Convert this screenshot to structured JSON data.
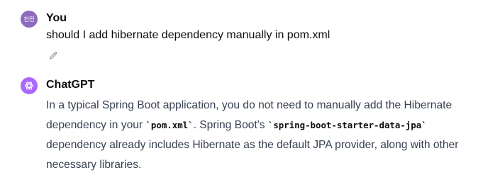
{
  "user_message": {
    "avatar_text": "찬민",
    "author": "You",
    "text": "should I add hibernate dependency manually in pom.xml",
    "edit_icon": "pencil-icon"
  },
  "assistant_message": {
    "avatar_icon": "openai-logo-icon",
    "author": "ChatGPT",
    "parts": {
      "p1": "In a typical Spring Boot application, you do not need to manually add the Hibernate dependency in your ",
      "code1": "`pom.xml`",
      "p2": ". Spring Boot's ",
      "code2": "`spring-boot-starter-data-jpa`",
      "p3": " dependency already includes Hibernate as the default JPA provider, along with other necessary libraries."
    }
  },
  "colors": {
    "user_avatar": "#8e6bbd",
    "assistant_avatar": "#ab68ff",
    "body_text": "#374151",
    "heading_text": "#0d0d0d"
  }
}
